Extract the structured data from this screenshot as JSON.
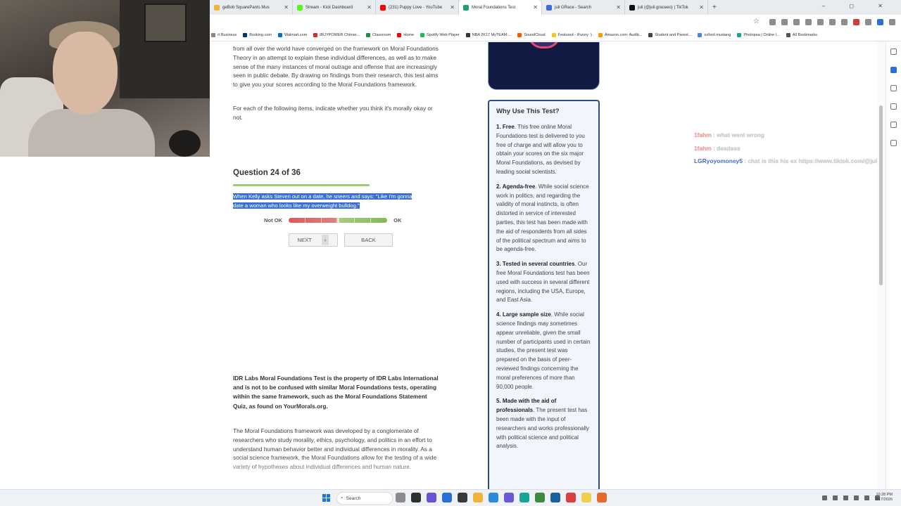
{
  "browser": {
    "tabs": [
      {
        "label": "geBob SquarePants Mus",
        "color": "#f2b33d",
        "active": false
      },
      {
        "label": "Stream - Kick Dashboard",
        "color": "#53fc18",
        "active": false
      },
      {
        "label": "(231) Puppy Love - YouTube",
        "color": "#ff0000",
        "active": false
      },
      {
        "label": "Moral Foundations Test",
        "color": "#1f9e74",
        "active": true
      },
      {
        "label": "juli GRace - Search",
        "color": "#3b6dd6",
        "active": false
      },
      {
        "label": "juli (@juli.graceeo) | TikTok",
        "color": "#111111",
        "active": false
      }
    ],
    "new_tab": "+",
    "window_controls": "– ◻ ✕",
    "bookmarks": [
      {
        "label": "rt Business",
        "color": "#888"
      },
      {
        "label": "Booking.com",
        "color": "#003580"
      },
      {
        "label": "Walmart.com",
        "color": "#0071ce"
      },
      {
        "label": "iBUYPOWER Chimer...",
        "color": "#d32f2f"
      },
      {
        "label": "Classroom",
        "color": "#1e8e3e"
      },
      {
        "label": "Home",
        "color": "#ff0000"
      },
      {
        "label": "Spotify Web Player",
        "color": "#1db954"
      },
      {
        "label": "NBA 2K17 MyTEAM:...",
        "color": "#333"
      },
      {
        "label": "SoundCloud",
        "color": "#ff5500"
      },
      {
        "label": "Featured - iFunny :)",
        "color": "#f5c518"
      },
      {
        "label": "Amazon.com: Audib...",
        "color": "#ff9900"
      },
      {
        "label": "Student and Parent...",
        "color": "#444"
      },
      {
        "label": "oxford mustang",
        "color": "#4285f4"
      },
      {
        "label": "Photopea | Online I...",
        "color": "#18a497"
      },
      {
        "label": "All Bookmarks",
        "color": "#555"
      }
    ],
    "star_icon": "☆"
  },
  "page": {
    "intro": "from all over the world have converged on the framework on Moral Foundations Theory in an attempt to explain these individual differences, as well as to make sense of the many instances of moral outrage and offense that are increasingly seen in public debate. By drawing on findings from their research, this test aims to give you your scores according to the Moral Foundations framework.",
    "instructions": "For each of the following items, indicate whether you think it's morally okay or not.",
    "question_title": "Question 24 of 36",
    "question_text": "When Kelly asks Steven out on a date, he sneers and says: \"Like I'm gonna date a woman who looks like my overweight bulldog.\"",
    "scale_left": "Not OK",
    "scale_right": "OK",
    "next_label": "NEXT",
    "next_chevron": "›",
    "back_label": "BACK",
    "legal": "IDR Labs Moral Foundations Test is the property of IDR Labs International and is not to be confused with similar Moral Foundations tests, operating within the same framework, such as the Moral Foundations Statement Quiz, as found on YourMorals.org.",
    "framework": "The Moral Foundations framework was developed by a conglomerate of researchers who study morality, ethics, psychology, and politics in an effort to understand human behavior better and individual differences in morality. As a social science framework, the Moral Foundations allow for the testing of a wide variety of hypotheses about individual differences and human nature."
  },
  "why": {
    "title": "Why Use This Test?",
    "items": [
      {
        "head": "1. Free",
        "body": ". This free online Moral Foundations test is delivered to you free of charge and will allow you to obtain your scores on the six major Moral Foundations, as devised by leading social scientists."
      },
      {
        "head": "2. Agenda-free",
        "body": ". While social science work in politics, and regarding the validity of moral instincts, is often distorted in service of interested parties, this test has been made with the aid of respondents from all sides of the political spectrum and aims to be agenda-free."
      },
      {
        "head": "3. Tested in several countries",
        "body": ". Our free Moral Foundations test has been used with success in several different regions, including the USA, Europe, and East Asia."
      },
      {
        "head": "4. Large sample size",
        "body": ". While social science findings may sometimes appear unreliable, given the small number of participants used in certain studies, the present test was prepared on the basis of peer-reviewed findings concerning the moral preferences of more than 90,000 people."
      },
      {
        "head": "5. Made with the aid of professionals",
        "body": ". The present test has been made with the input of researchers and works professionally with political science and political analysis."
      }
    ]
  },
  "chat": [
    {
      "user": "1fahm",
      "msg": " : what went wrong"
    },
    {
      "user": "1fahm",
      "msg": " : deadass"
    },
    {
      "user": "LGRyoyomoney5",
      "msg": " : chat is this his ex https://www.tiktok.com/@juli"
    }
  ],
  "taskbar": {
    "search_placeholder": "Search",
    "time": "10:28 PM",
    "date": "3/17/2026"
  }
}
